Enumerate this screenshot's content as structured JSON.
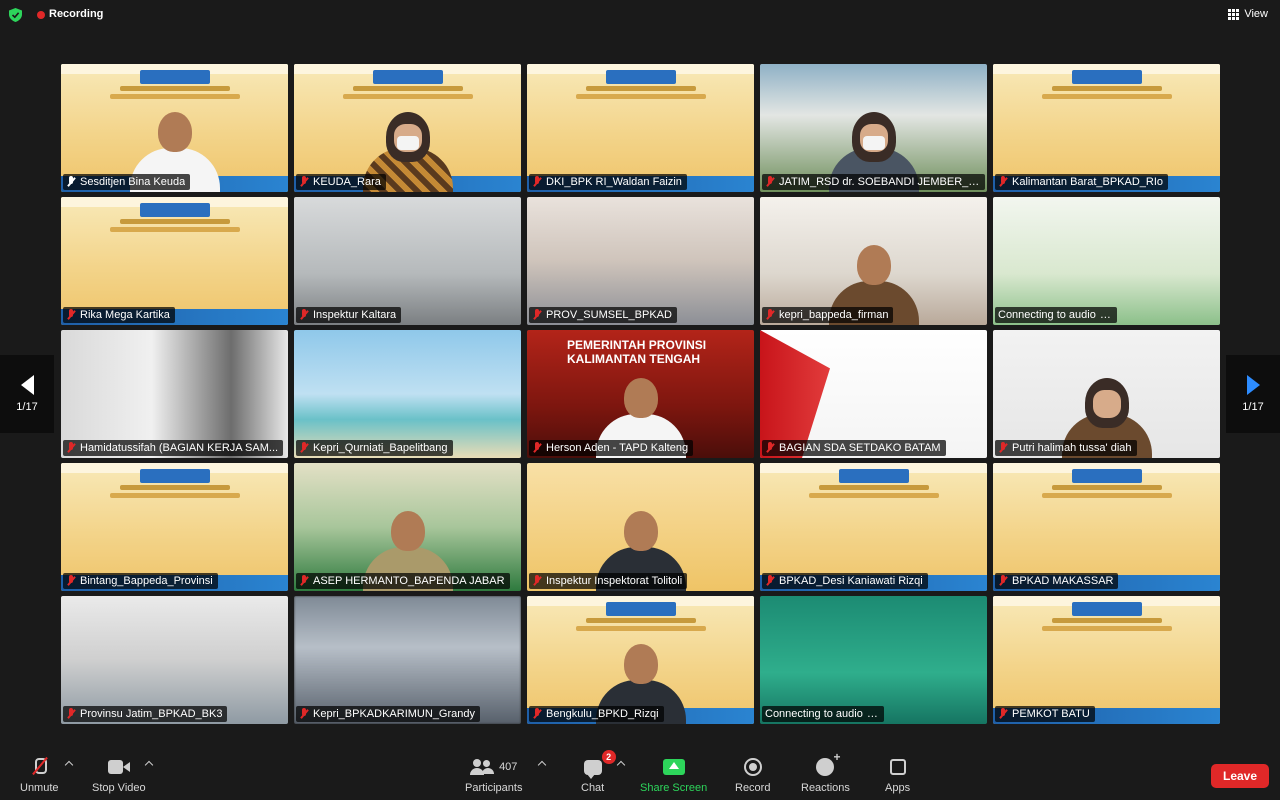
{
  "topbar": {
    "recording_label": "Recording",
    "view_label": "View",
    "colors": {
      "shield": "#2dd55b",
      "recording_dot": "#e02828"
    }
  },
  "pagination": {
    "left": "1/17",
    "right": "1/17"
  },
  "participants": [
    {
      "name": "Sesditjen Bina Keuda",
      "scene": "webinar",
      "person": "man-white",
      "mic": "on",
      "active": true
    },
    {
      "name": "KEUDA_Rara",
      "scene": "webinar",
      "person": "hijab-batik",
      "mic": "muted"
    },
    {
      "name": "DKI_BPK RI_Waldan Faizin",
      "scene": "webinar",
      "person": "",
      "mic": "muted"
    },
    {
      "name": "JATIM_RSD dr. SOEBANDI JEMBER_F...",
      "scene": "building",
      "person": "hijab-mask",
      "mic": "muted"
    },
    {
      "name": "Kalimantan Barat_BPKAD_RIo",
      "scene": "webinar",
      "person": "",
      "mic": "muted"
    },
    {
      "name": "Rika Mega Kartika",
      "scene": "webinar",
      "person": "",
      "mic": "muted"
    },
    {
      "name": "Inspektur Kaltara",
      "scene": "office",
      "person": "",
      "mic": "muted"
    },
    {
      "name": "PROV_SUMSEL_BPKAD",
      "scene": "meeting",
      "person": "",
      "mic": "muted"
    },
    {
      "name": "kepri_bappeda_firman",
      "scene": "person",
      "person": "man-smile",
      "mic": "muted"
    },
    {
      "name": "Connecting to audio",
      "scene": "green",
      "person": "",
      "mic": "none",
      "connecting": true
    },
    {
      "name": "Hamidatussifah (BAGIAN KERJA SAM...",
      "scene": "curtain",
      "person": "",
      "mic": "muted"
    },
    {
      "name": "Kepri_Qurniati_Bapelitbang",
      "scene": "beach",
      "person": "",
      "mic": "muted"
    },
    {
      "name": "Herson Aden - TAPD Kalteng",
      "scene": "red",
      "person": "man-white",
      "mic": "muted",
      "banner": "PEMERINTAH PROVINSI\nKALIMANTAN TENGAH"
    },
    {
      "name": "BAGIAN SDA SETDAKO BATAM",
      "scene": "white",
      "person": "",
      "mic": "muted"
    },
    {
      "name": "Putri halimah tussa' diah",
      "scene": "hijab",
      "person": "hijab",
      "mic": "muted"
    },
    {
      "name": "Bintang_Bappeda_Provinsi",
      "scene": "webinar",
      "person": "",
      "mic": "muted"
    },
    {
      "name": "ASEP HERMANTO_BAPENDA JABAR",
      "scene": "green-stage",
      "person": "man-khaki",
      "mic": "muted"
    },
    {
      "name": "Inspektur Inspektorat Tolitoli",
      "scene": "infog",
      "person": "man-dark",
      "mic": "muted"
    },
    {
      "name": "BPKAD_Desi Kaniawati Rizqi",
      "scene": "webinar",
      "person": "",
      "mic": "muted"
    },
    {
      "name": "BPKAD MAKASSAR",
      "scene": "webinar",
      "person": "",
      "mic": "muted"
    },
    {
      "name": "Provinsu Jatim_BPKAD_BK3",
      "scene": "room",
      "person": "",
      "mic": "muted"
    },
    {
      "name": "Kepri_BPKADKARIMUN_Grandy",
      "scene": "blur",
      "person": "",
      "mic": "muted"
    },
    {
      "name": "Bengkulu_BPKD_Rizqi",
      "scene": "webinar",
      "person": "man-dark",
      "mic": "muted"
    },
    {
      "name": "Connecting to audio",
      "scene": "teal",
      "person": "",
      "mic": "none",
      "connecting": true
    },
    {
      "name": "PEMKOT BATU",
      "scene": "webinar",
      "person": "",
      "mic": "muted"
    }
  ],
  "toolbar": {
    "unmute": "Unmute",
    "stop_video": "Stop Video",
    "participants": "Participants",
    "participant_count": "407",
    "chat": "Chat",
    "chat_badge": "2",
    "share_screen": "Share Screen",
    "record": "Record",
    "reactions": "Reactions",
    "apps": "Apps",
    "leave": "Leave",
    "colors": {
      "share": "#2dd55b",
      "leave": "#e02828",
      "muted": "#e02828"
    }
  }
}
